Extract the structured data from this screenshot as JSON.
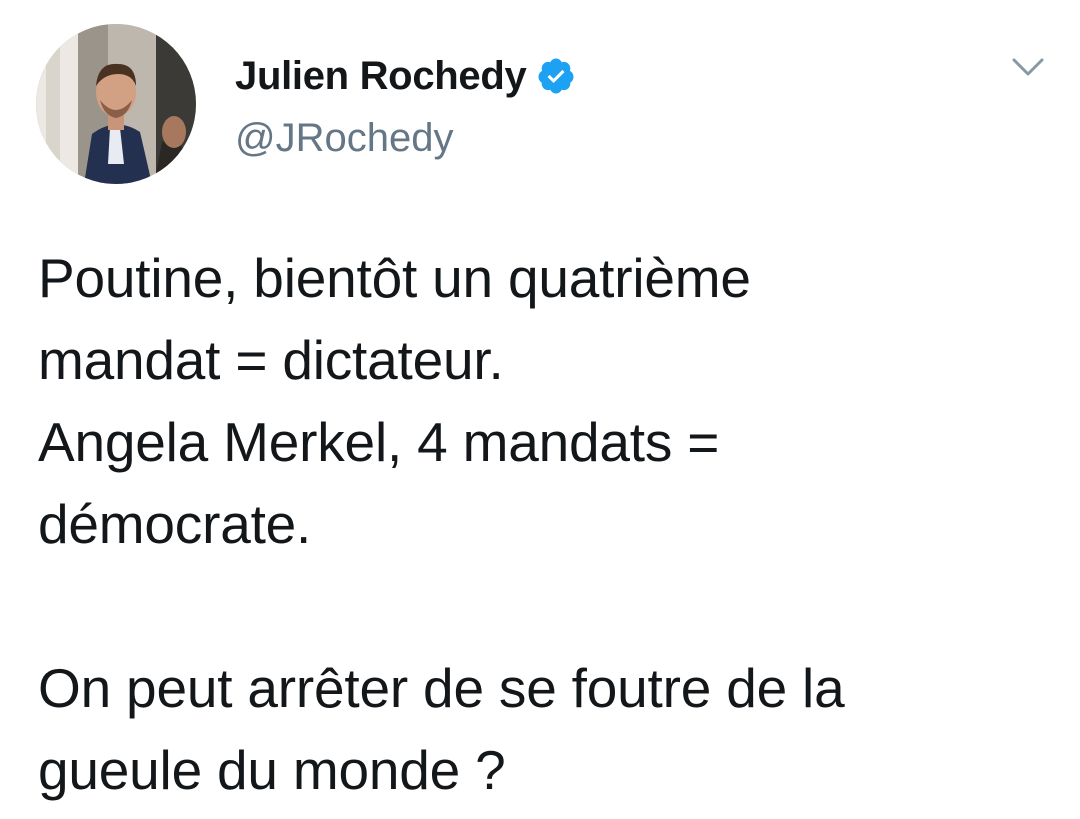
{
  "user": {
    "display_name": "Julien Rochedy",
    "handle": "@JRochedy",
    "verified": true
  },
  "tweet": {
    "paragraph_1": "Poutine, bientôt un quatrième\nmandat = dictateur.\nAngela Merkel, 4 mandats =\ndémocrate.",
    "paragraph_2": "On peut arrêter de se foutre de la\ngueule du monde ?"
  },
  "icons": {
    "verified": "verified-badge-icon",
    "caret": "chevron-down-icon"
  },
  "colors": {
    "text": "#14171a",
    "secondary": "#657786",
    "verified": "#1da1f2",
    "background": "#ffffff"
  }
}
